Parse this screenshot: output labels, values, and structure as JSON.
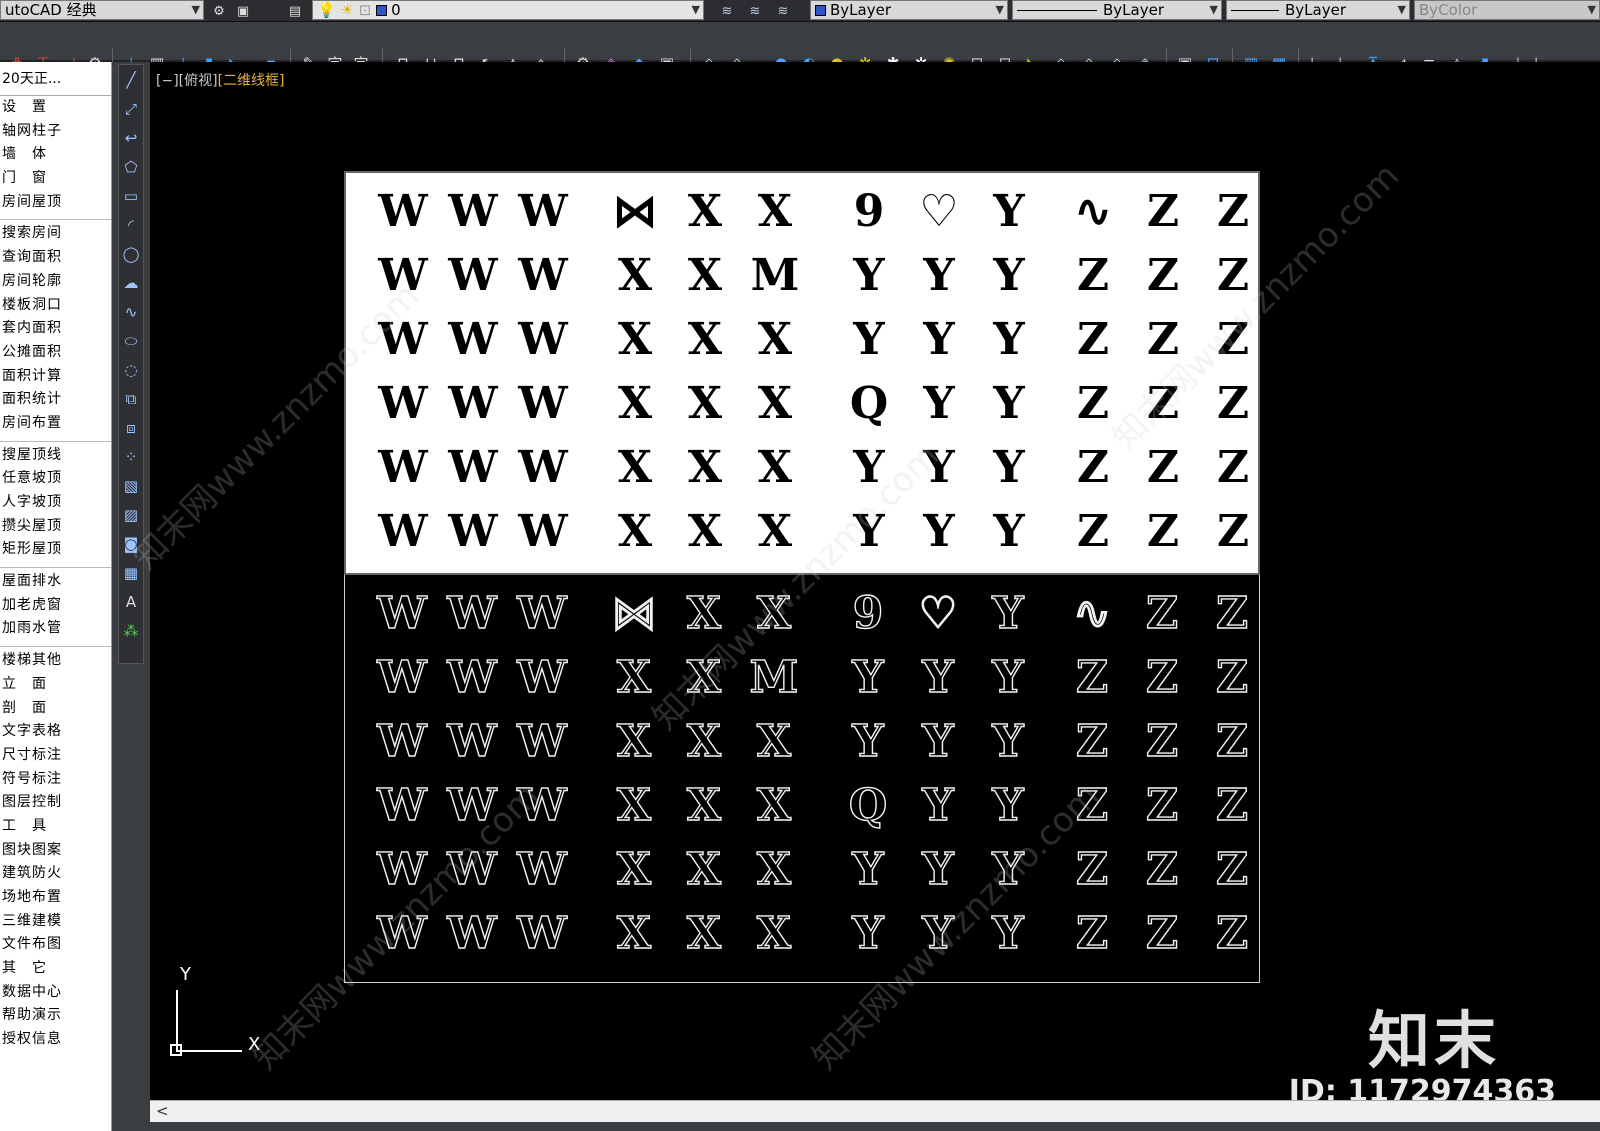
{
  "toolbar_top": {
    "workspace": "utoCAD 经典",
    "layer": "0",
    "color": "ByLayer",
    "linetype": "ByLayer",
    "lineweight": "ByLayer",
    "plotstyle": "ByColor"
  },
  "side_menu": {
    "title": "20天正...",
    "groups": [
      [
        "设　置",
        "轴网柱子",
        "墙　体",
        "门　窗",
        "房间屋顶"
      ],
      [
        "搜索房间",
        "查询面积",
        "房间轮廓",
        "楼板洞口",
        "套内面积",
        "公摊面积",
        "面积计算",
        "面积统计",
        "房间布置"
      ],
      [
        "搜屋顶线",
        "任意坡顶",
        "人字坡顶",
        "攒尖屋顶",
        "矩形屋顶"
      ],
      [
        "屋面排水",
        "加老虎窗",
        "加雨水管"
      ],
      [
        "楼梯其他",
        "立　面",
        "剖　面",
        "文字表格",
        "尺寸标注",
        "符号标注",
        "图层控制",
        "工　具",
        "图块图案",
        "建筑防火",
        "场地布置",
        "三维建模",
        "文件布图",
        "其　它",
        "数据中心",
        "帮助演示",
        "授权信息"
      ]
    ]
  },
  "viewport": {
    "label_prefix": "[−][俯视]",
    "label_visual": "[二维线框]",
    "ucs_y": "Y",
    "ucs_x": "X"
  },
  "drawing": {
    "rows": [
      [
        "W",
        "W",
        "W",
        "⋈",
        "X",
        "X",
        "9",
        "♡",
        "Y",
        "∿",
        "Z",
        "Z"
      ],
      [
        "W",
        "W",
        "W",
        "X",
        "X",
        "M",
        "Y",
        "Y",
        "Y",
        "Z",
        "Z",
        "Z"
      ],
      [
        "W",
        "W",
        "W",
        "X",
        "X",
        "X",
        "Y",
        "Y",
        "Y",
        "Z",
        "Z",
        "Z"
      ],
      [
        "W",
        "W",
        "W",
        "X",
        "X",
        "X",
        "Q",
        "Y",
        "Y",
        "Z",
        "Z",
        "Z"
      ],
      [
        "W",
        "W",
        "W",
        "X",
        "X",
        "X",
        "Y",
        "Y",
        "Y",
        "Z",
        "Z",
        "Z"
      ],
      [
        "W",
        "W",
        "W",
        "X",
        "X",
        "X",
        "Y",
        "Y",
        "Y",
        "Z",
        "Z",
        "Z"
      ]
    ]
  },
  "watermark": {
    "brand": "知末",
    "id": "ID: 1172974363",
    "diagonal": "知末网www.znzmo.com"
  },
  "colors": {
    "canvas": "#000000",
    "layer_swatch": "#2f55c9",
    "visual_style": "#e8b23a"
  }
}
